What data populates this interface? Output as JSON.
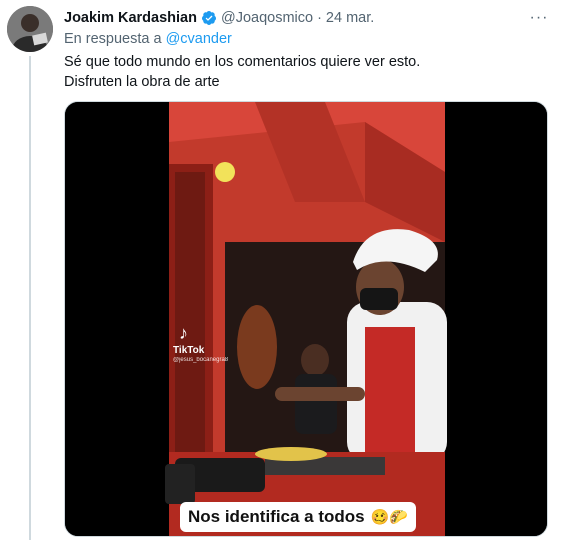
{
  "tweet": {
    "author": {
      "display_name": "Joakim Kardashian",
      "handle": "@Joaqosmico",
      "verified": true
    },
    "separator": "·",
    "date": "24 mar.",
    "more_label": "···",
    "reply": {
      "prefix": "En respuesta a",
      "mention": "@cvander"
    },
    "text_lines": [
      "Sé que todo mundo en los comentarios quiere ver esto.",
      "Disfruten la obra de arte"
    ],
    "media": {
      "watermark": {
        "icon": "tiktok-icon",
        "name": "TikTok",
        "user": "@jesus_bocanegra8"
      },
      "caption": "Nos identifica a todos",
      "caption_emoji": "🥴🌮"
    }
  },
  "colors": {
    "text": "#0f1419",
    "secondary": "#536471",
    "link": "#1d9bf0",
    "verified": "#1d9bf0"
  }
}
